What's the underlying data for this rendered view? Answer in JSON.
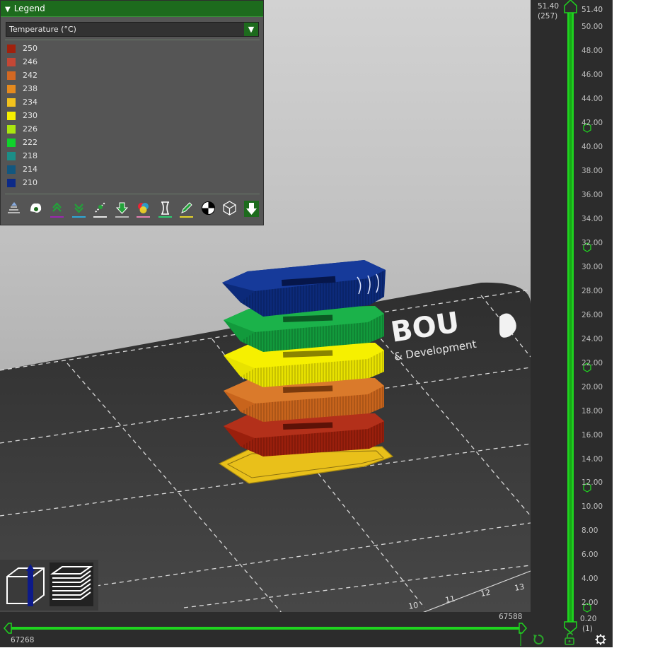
{
  "legend": {
    "title": "Legend",
    "dropdown_value": "Temperature (°C)",
    "items": [
      {
        "label": "250",
        "color": "#a1210d"
      },
      {
        "label": "246",
        "color": "#c44735"
      },
      {
        "label": "242",
        "color": "#d36822"
      },
      {
        "label": "238",
        "color": "#e58a1e"
      },
      {
        "label": "234",
        "color": "#f2c21d"
      },
      {
        "label": "230",
        "color": "#f6f000"
      },
      {
        "label": "226",
        "color": "#aae60f"
      },
      {
        "label": "222",
        "color": "#0fd22b"
      },
      {
        "label": "218",
        "color": "#1b8e87"
      },
      {
        "label": "214",
        "color": "#12577f"
      },
      {
        "label": "210",
        "color": "#0c2a88"
      }
    ],
    "toolbar": [
      {
        "name": "travel-icon",
        "underline": ""
      },
      {
        "name": "wipe-icon",
        "underline": ""
      },
      {
        "name": "retractions-icon",
        "underline": "#9b27b0"
      },
      {
        "name": "deretractions-icon",
        "underline": "#2ea8d8"
      },
      {
        "name": "seams-icon",
        "underline": "#e6e6e6"
      },
      {
        "name": "tool-changes-icon",
        "underline": "#b9b9b9"
      },
      {
        "name": "color-changes-icon",
        "underline": "#e27fb0"
      },
      {
        "name": "pause-prints-icon",
        "underline": "#2ecc71"
      },
      {
        "name": "custom-gcodes-icon",
        "underline": "#e5d32a"
      },
      {
        "name": "center-of-gravity-icon",
        "underline": ""
      },
      {
        "name": "shells-icon",
        "underline": ""
      },
      {
        "name": "tool-marker-icon",
        "underline": ""
      }
    ]
  },
  "bed": {
    "logo_text": "BOU",
    "subtitle_text": "& Development",
    "ruler_numbers": [
      "10",
      "11",
      "12",
      "13"
    ]
  },
  "view_buttons": {
    "items": [
      "3d-view-icon",
      "layers-view-icon"
    ]
  },
  "vertical_slider": {
    "top_value": "51.40",
    "top_layer": "(257)",
    "bottom_value": "0.20",
    "bottom_layer": "(1)",
    "ticks": [
      "51.40",
      "50.00",
      "48.00",
      "46.00",
      "44.00",
      "42.00",
      "40.00",
      "38.00",
      "36.00",
      "34.00",
      "32.00",
      "30.00",
      "28.00",
      "26.00",
      "24.00",
      "22.00",
      "20.00",
      "18.00",
      "16.00",
      "14.00",
      "12.00",
      "10.00",
      "8.00",
      "6.00",
      "4.00",
      "2.00",
      "0.20"
    ],
    "color_change_markers": 5,
    "accent": "#1fd41f"
  },
  "horizontal_slider": {
    "left_value": "67268",
    "right_value": "67588",
    "accent": "#1fd41f"
  },
  "bottom_icons": [
    "undo-arrow-icon",
    "unlock-icon",
    "settings-cog-icon"
  ]
}
